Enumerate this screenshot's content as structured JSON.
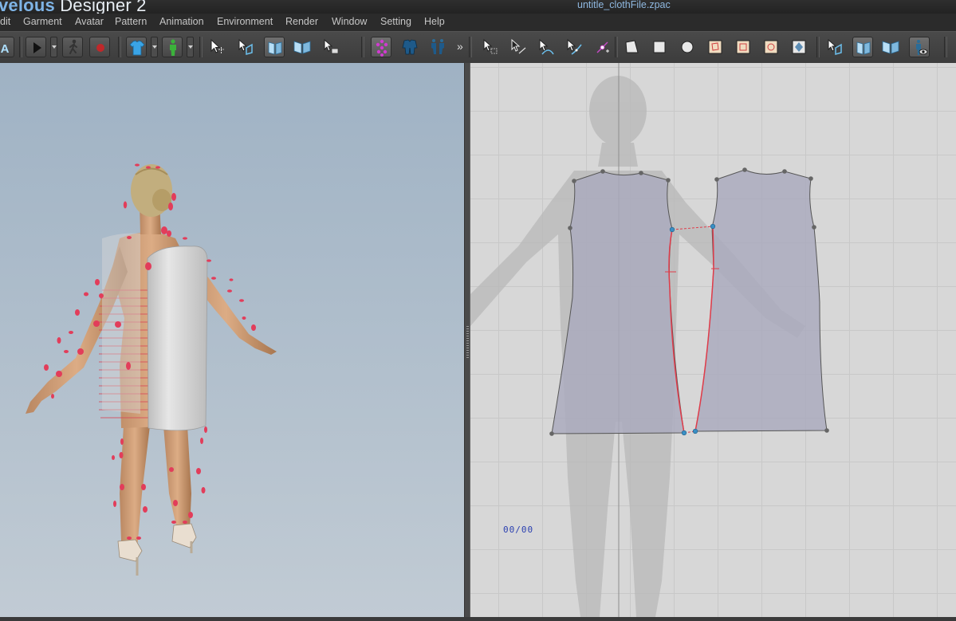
{
  "title_bar": {
    "app_title_brand": "velous",
    "app_title_rest": " Designer 2",
    "file_name": "untitle_clothFile.zpac"
  },
  "menu": {
    "items": [
      "dit",
      "Garment",
      "Avatar",
      "Pattern",
      "Animation",
      "Environment",
      "Render",
      "Window",
      "Setting",
      "Help"
    ]
  },
  "toolbar": {
    "left_tools": [
      {
        "icon": "text-tool-icon",
        "glyph": "A"
      },
      {
        "icon": "play-simulation-icon"
      },
      {
        "icon": "walk-animation-icon"
      },
      {
        "icon": "record-icon"
      },
      {
        "icon": "garment-shirt-icon"
      },
      {
        "icon": "avatar-figure-icon"
      },
      {
        "icon": "select-move-icon"
      },
      {
        "icon": "select-mesh-icon"
      },
      {
        "icon": "fold-arrange-icon"
      },
      {
        "icon": "unfold-icon"
      },
      {
        "icon": "select-pattern-icon"
      },
      {
        "icon": "arrangement-points-icon"
      },
      {
        "icon": "garment-front-icon"
      },
      {
        "icon": "garment-back-icon"
      }
    ],
    "right_tools": [
      {
        "icon": "transform-pattern-icon"
      },
      {
        "icon": "edit-pattern-icon"
      },
      {
        "icon": "edit-curvature-icon"
      },
      {
        "icon": "edit-curve-point-icon"
      },
      {
        "icon": "add-point-icon"
      },
      {
        "icon": "polygon-icon"
      },
      {
        "icon": "rectangle-icon"
      },
      {
        "icon": "circle-icon"
      },
      {
        "icon": "internal-polygon-icon"
      },
      {
        "icon": "internal-rectangle-icon"
      },
      {
        "icon": "internal-circle-icon"
      },
      {
        "icon": "dart-icon"
      },
      {
        "icon": "select-move-2d-icon"
      },
      {
        "icon": "fold-2d-icon"
      },
      {
        "icon": "unfold-2d-icon"
      },
      {
        "icon": "show-avatar-icon"
      }
    ],
    "overflow": "»"
  },
  "view2d": {
    "counter": "00/00",
    "accent_seam_color": "#e03c4a",
    "pattern_fill_color": "#a9a9bd"
  },
  "colors": {
    "sky_top": "#9fb2c4",
    "grid_bg": "#d7d7d7",
    "seam_red": "#e03c4a",
    "point_blue": "#3a8fc4"
  }
}
